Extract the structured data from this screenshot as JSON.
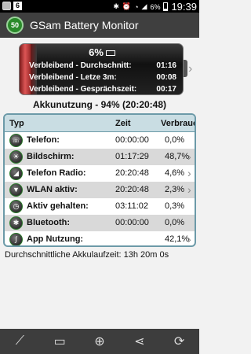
{
  "status_bar": {
    "notification_count": "6",
    "battery_pct": "6%",
    "time": "19:39"
  },
  "app": {
    "logo_text": "50",
    "title": "GSam Battery Monitor"
  },
  "battery": {
    "percent": "6%",
    "level_fraction": 0.06,
    "rows": [
      {
        "label": "Verbleibend - Durchschnitt:",
        "value": "01:16"
      },
      {
        "label": "Verbleibend - Letze 3m:",
        "value": "00:08"
      },
      {
        "label": "Verbleibend - Gesprächszeit:",
        "value": "00:17"
      }
    ]
  },
  "usage_heading": "Akkunutzung - 94% (20:20:48)",
  "table": {
    "headers": {
      "type": "Typ",
      "time": "Zeit",
      "usage": "Verbrauch"
    },
    "rows": [
      {
        "name": "Telefon:",
        "time": "00:00:00",
        "pct": "0,0%",
        "icon": "phone-icon",
        "chevron": false
      },
      {
        "name": "Bildschirm:",
        "time": "01:17:29",
        "pct": "48,7%",
        "icon": "screen-icon",
        "chevron": true
      },
      {
        "name": "Telefon Radio:",
        "time": "20:20:48",
        "pct": "4,6%",
        "icon": "signal-icon",
        "chevron": true
      },
      {
        "name": "WLAN aktiv:",
        "time": "20:20:48",
        "pct": "2,3%",
        "icon": "wifi-icon",
        "chevron": true
      },
      {
        "name": "Aktiv gehalten:",
        "time": "03:11:02",
        "pct": "0,3%",
        "icon": "clock-icon",
        "chevron": false
      },
      {
        "name": "Bluetooth:",
        "time": "00:00:00",
        "pct": "0,0%",
        "icon": "bluetooth-icon",
        "chevron": false
      },
      {
        "name": "App Nutzung:",
        "time": "",
        "pct": "42,1%",
        "icon": "apps-icon",
        "chevron": true
      }
    ]
  },
  "average_runtime": "Durchschnittliche Akkulaufzeit: 13h 20m 0s",
  "colors": {
    "title_bar": "#3f3f3f",
    "table_border": "#6c9aa8",
    "table_header": "#c9dde3",
    "battery_red": "#d55555"
  }
}
